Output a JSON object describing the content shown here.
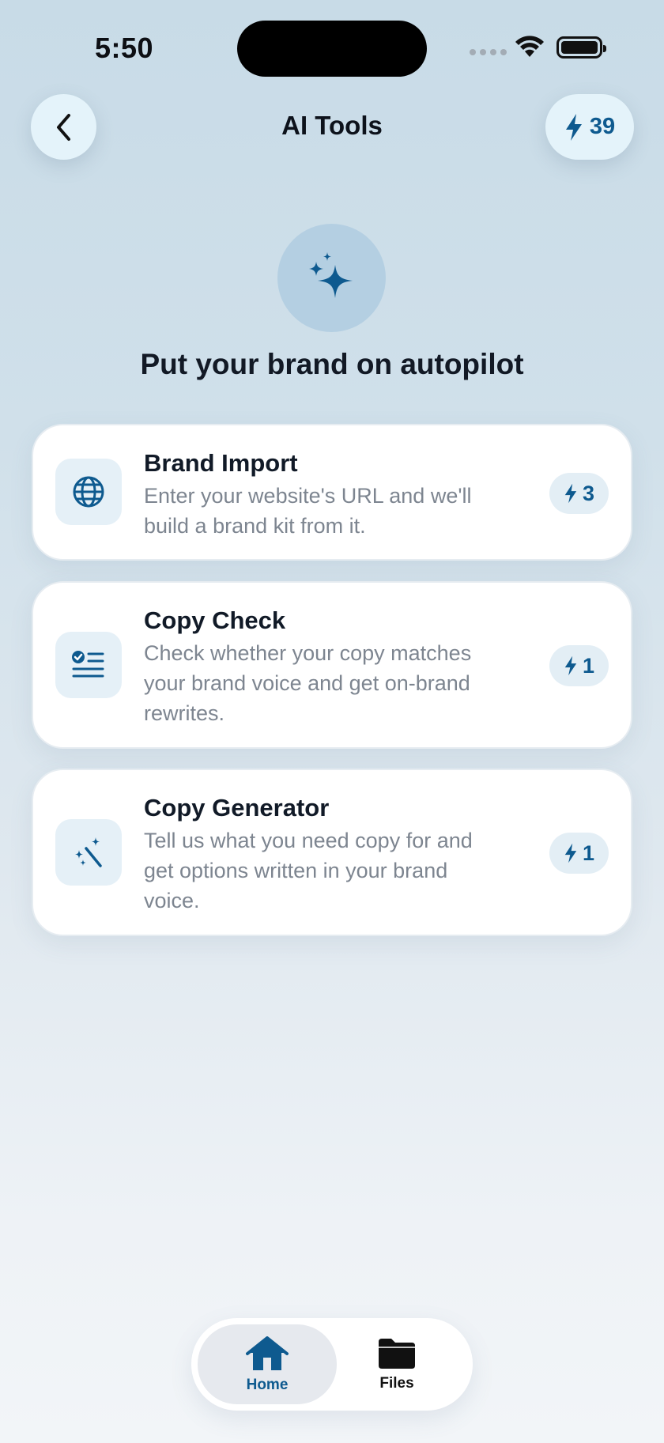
{
  "status_bar": {
    "time": "5:50"
  },
  "header": {
    "title": "AI Tools",
    "credits": "39"
  },
  "hero": {
    "title": "Put your brand on autopilot"
  },
  "tools": [
    {
      "title": "Brand Import",
      "description": "Enter your website's URL and we'll build a brand kit from it.",
      "cost": "3"
    },
    {
      "title": "Copy Check",
      "description": "Check whether your copy matches your brand voice and get on-brand rewrites.",
      "cost": "1"
    },
    {
      "title": "Copy Generator",
      "description": "Tell us what you need copy for and get options written in your brand voice.",
      "cost": "1"
    }
  ],
  "tabbar": {
    "home": "Home",
    "files": "Files"
  },
  "colors": {
    "accent": "#0e5a8f",
    "icon_bg": "#e5f0f7"
  }
}
